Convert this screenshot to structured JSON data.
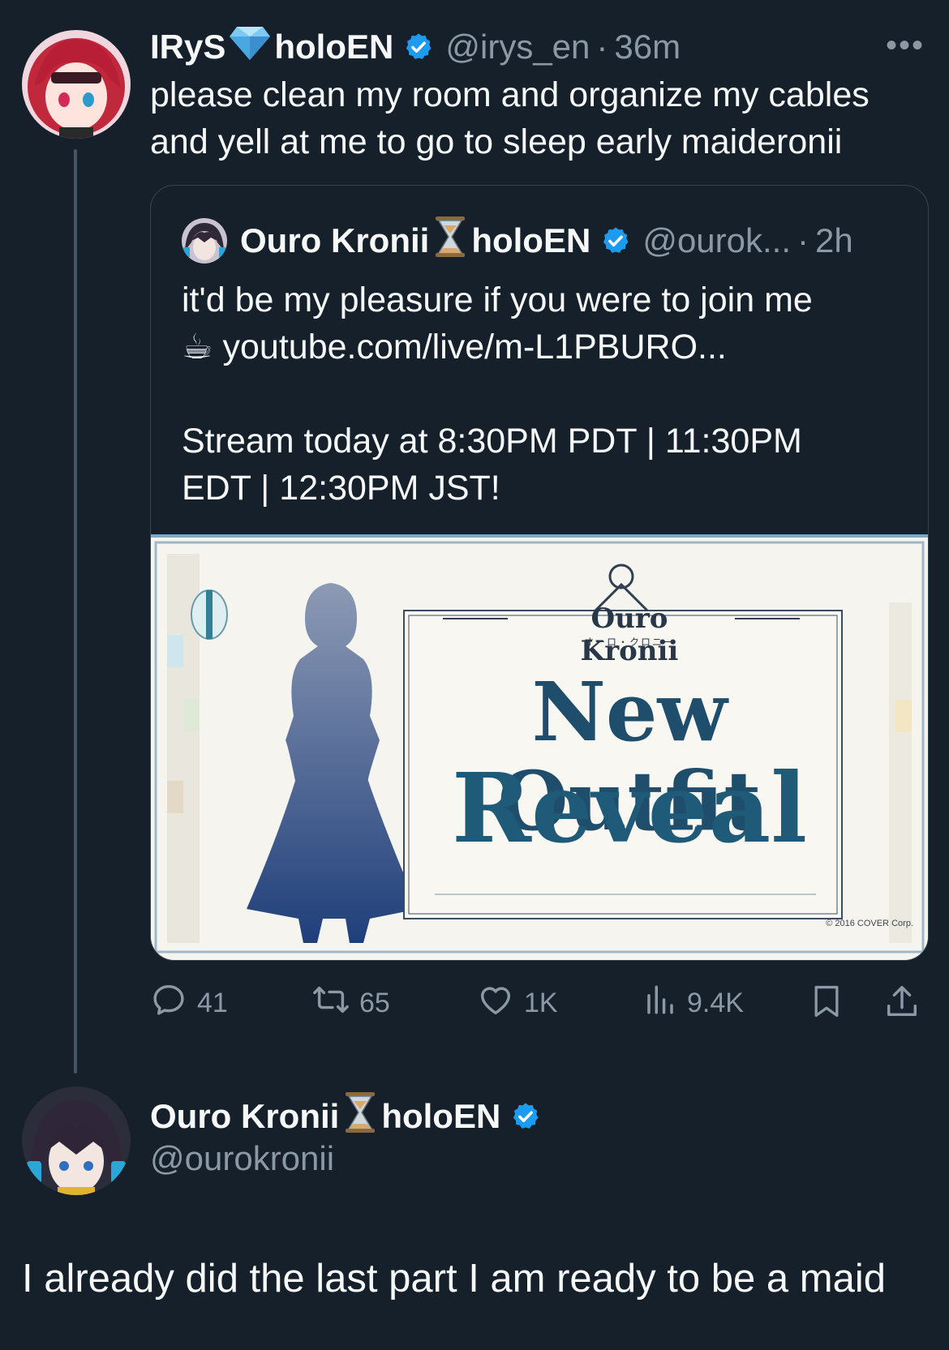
{
  "tweet": {
    "author_name": "IRyS",
    "author_name_suffix": "holoEN",
    "handle": "@irys_en",
    "separator": "·",
    "time": "36m",
    "more_label": "•••",
    "text": "please clean my room and organize my cables and yell at me to go to sleep early maideronii"
  },
  "quote": {
    "author_name": "Ouro Kronii",
    "author_name_suffix": "holoEN",
    "handle": "@ourok...",
    "separator": "·",
    "time": "2h",
    "line1": "it'd be my pleasure if you were to join me",
    "line2_icon": "☕",
    "line2": "youtube.com/live/m-L1PBURO...",
    "line3": "Stream today at 8:30PM PDT | 11:30PM",
    "line4": "EDT | 12:30PM JST!",
    "media": {
      "brand": "Ouro Kronii",
      "brand_kana": "オーロ・クロニー",
      "title_line1": "New Outfit",
      "title_line2": "Reveal",
      "copyright": "© 2016 COVER Corp."
    }
  },
  "actions": {
    "replies": "41",
    "reposts": "65",
    "likes": "1K",
    "views": "9.4K"
  },
  "reply": {
    "author_name": "Ouro Kronii",
    "author_name_suffix": "holoEN",
    "handle": "@ourokronii",
    "text": "I already did the last part I am ready to be a maid"
  },
  "colors": {
    "background": "#15202b",
    "text": "#f7f9f9",
    "muted": "#8b98a5",
    "verified": "#1d9bf0",
    "border": "#38444d"
  }
}
